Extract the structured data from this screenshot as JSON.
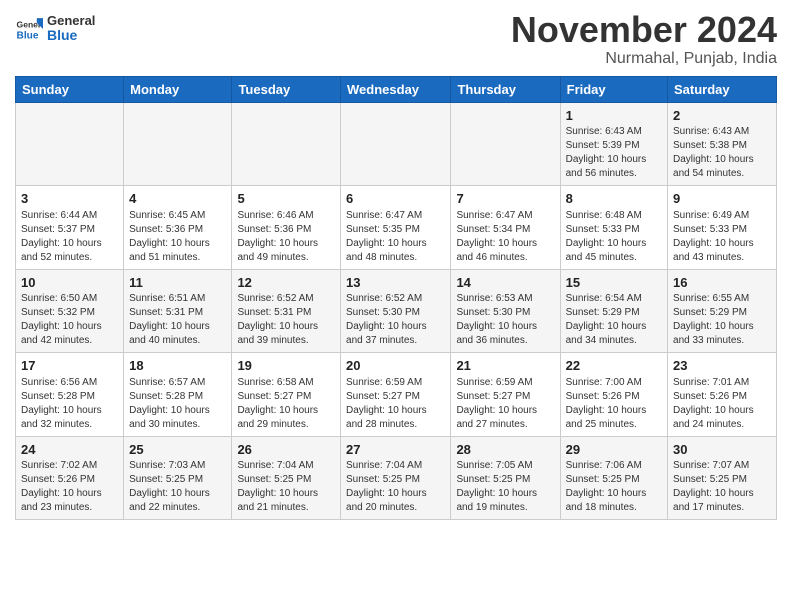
{
  "header": {
    "logo_line1": "General",
    "logo_line2": "Blue",
    "month_title": "November 2024",
    "location": "Nurmahal, Punjab, India"
  },
  "weekdays": [
    "Sunday",
    "Monday",
    "Tuesday",
    "Wednesday",
    "Thursday",
    "Friday",
    "Saturday"
  ],
  "weeks": [
    [
      {
        "day": "",
        "info": ""
      },
      {
        "day": "",
        "info": ""
      },
      {
        "day": "",
        "info": ""
      },
      {
        "day": "",
        "info": ""
      },
      {
        "day": "",
        "info": ""
      },
      {
        "day": "1",
        "info": "Sunrise: 6:43 AM\nSunset: 5:39 PM\nDaylight: 10 hours\nand 56 minutes."
      },
      {
        "day": "2",
        "info": "Sunrise: 6:43 AM\nSunset: 5:38 PM\nDaylight: 10 hours\nand 54 minutes."
      }
    ],
    [
      {
        "day": "3",
        "info": "Sunrise: 6:44 AM\nSunset: 5:37 PM\nDaylight: 10 hours\nand 52 minutes."
      },
      {
        "day": "4",
        "info": "Sunrise: 6:45 AM\nSunset: 5:36 PM\nDaylight: 10 hours\nand 51 minutes."
      },
      {
        "day": "5",
        "info": "Sunrise: 6:46 AM\nSunset: 5:36 PM\nDaylight: 10 hours\nand 49 minutes."
      },
      {
        "day": "6",
        "info": "Sunrise: 6:47 AM\nSunset: 5:35 PM\nDaylight: 10 hours\nand 48 minutes."
      },
      {
        "day": "7",
        "info": "Sunrise: 6:47 AM\nSunset: 5:34 PM\nDaylight: 10 hours\nand 46 minutes."
      },
      {
        "day": "8",
        "info": "Sunrise: 6:48 AM\nSunset: 5:33 PM\nDaylight: 10 hours\nand 45 minutes."
      },
      {
        "day": "9",
        "info": "Sunrise: 6:49 AM\nSunset: 5:33 PM\nDaylight: 10 hours\nand 43 minutes."
      }
    ],
    [
      {
        "day": "10",
        "info": "Sunrise: 6:50 AM\nSunset: 5:32 PM\nDaylight: 10 hours\nand 42 minutes."
      },
      {
        "day": "11",
        "info": "Sunrise: 6:51 AM\nSunset: 5:31 PM\nDaylight: 10 hours\nand 40 minutes."
      },
      {
        "day": "12",
        "info": "Sunrise: 6:52 AM\nSunset: 5:31 PM\nDaylight: 10 hours\nand 39 minutes."
      },
      {
        "day": "13",
        "info": "Sunrise: 6:52 AM\nSunset: 5:30 PM\nDaylight: 10 hours\nand 37 minutes."
      },
      {
        "day": "14",
        "info": "Sunrise: 6:53 AM\nSunset: 5:30 PM\nDaylight: 10 hours\nand 36 minutes."
      },
      {
        "day": "15",
        "info": "Sunrise: 6:54 AM\nSunset: 5:29 PM\nDaylight: 10 hours\nand 34 minutes."
      },
      {
        "day": "16",
        "info": "Sunrise: 6:55 AM\nSunset: 5:29 PM\nDaylight: 10 hours\nand 33 minutes."
      }
    ],
    [
      {
        "day": "17",
        "info": "Sunrise: 6:56 AM\nSunset: 5:28 PM\nDaylight: 10 hours\nand 32 minutes."
      },
      {
        "day": "18",
        "info": "Sunrise: 6:57 AM\nSunset: 5:28 PM\nDaylight: 10 hours\nand 30 minutes."
      },
      {
        "day": "19",
        "info": "Sunrise: 6:58 AM\nSunset: 5:27 PM\nDaylight: 10 hours\nand 29 minutes."
      },
      {
        "day": "20",
        "info": "Sunrise: 6:59 AM\nSunset: 5:27 PM\nDaylight: 10 hours\nand 28 minutes."
      },
      {
        "day": "21",
        "info": "Sunrise: 6:59 AM\nSunset: 5:27 PM\nDaylight: 10 hours\nand 27 minutes."
      },
      {
        "day": "22",
        "info": "Sunrise: 7:00 AM\nSunset: 5:26 PM\nDaylight: 10 hours\nand 25 minutes."
      },
      {
        "day": "23",
        "info": "Sunrise: 7:01 AM\nSunset: 5:26 PM\nDaylight: 10 hours\nand 24 minutes."
      }
    ],
    [
      {
        "day": "24",
        "info": "Sunrise: 7:02 AM\nSunset: 5:26 PM\nDaylight: 10 hours\nand 23 minutes."
      },
      {
        "day": "25",
        "info": "Sunrise: 7:03 AM\nSunset: 5:25 PM\nDaylight: 10 hours\nand 22 minutes."
      },
      {
        "day": "26",
        "info": "Sunrise: 7:04 AM\nSunset: 5:25 PM\nDaylight: 10 hours\nand 21 minutes."
      },
      {
        "day": "27",
        "info": "Sunrise: 7:04 AM\nSunset: 5:25 PM\nDaylight: 10 hours\nand 20 minutes."
      },
      {
        "day": "28",
        "info": "Sunrise: 7:05 AM\nSunset: 5:25 PM\nDaylight: 10 hours\nand 19 minutes."
      },
      {
        "day": "29",
        "info": "Sunrise: 7:06 AM\nSunset: 5:25 PM\nDaylight: 10 hours\nand 18 minutes."
      },
      {
        "day": "30",
        "info": "Sunrise: 7:07 AM\nSunset: 5:25 PM\nDaylight: 10 hours\nand 17 minutes."
      }
    ]
  ]
}
